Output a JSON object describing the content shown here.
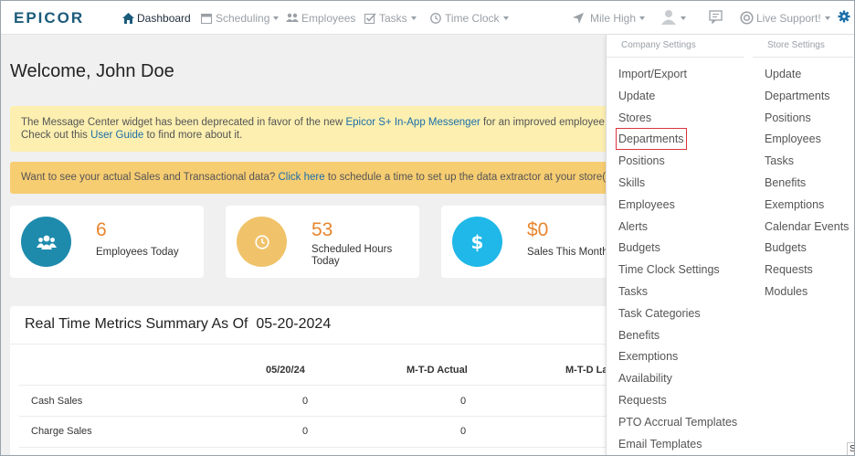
{
  "brand": {
    "logo_text": "EPICOR",
    "logo_color": "#1b5b7a"
  },
  "nav": {
    "dashboard": "Dashboard",
    "scheduling": "Scheduling",
    "employees": "Employees",
    "tasks": "Tasks",
    "time_clock": "Time Clock",
    "store": "Mile High",
    "support": "Live Support!"
  },
  "welcome": "Welcome, John Doe",
  "alerts": {
    "message_center": {
      "line1_a": "The Message Center widget has been deprecated in favor of the new ",
      "line1_link": "Epicor S+ In-App Messenger",
      "line1_b": " for an improved employee collab",
      "line2_a": "Check out this ",
      "line2_link": "User Guide",
      "line2_b": " to find more about it."
    },
    "sales_data": {
      "text_a": "Want to see your actual Sales and Transactional data? ",
      "link": "Click here",
      "text_b": " to schedule a time to set up the data extractor at your store(s)."
    }
  },
  "cards": [
    {
      "value": "6",
      "label": "Employees Today",
      "icon": "users-icon",
      "color": "#1e8bad"
    },
    {
      "value": "53",
      "label": "Scheduled Hours Today",
      "label_line1": "Scheduled Hours",
      "label_line2": "Today",
      "icon": "clock-icon",
      "color": "#f0c36a"
    },
    {
      "value": "$0",
      "label": "Sales This Month",
      "icon": "dollar-icon",
      "color": "#1fb8e8"
    }
  ],
  "metrics": {
    "title": "Real Time Metrics Summary As Of  05-20-2024",
    "columns": [
      "05/20/24",
      "M-T-D Actual",
      "M-T-D La"
    ],
    "rows": [
      {
        "label": "Cash Sales",
        "values": [
          "0",
          "0"
        ]
      },
      {
        "label": "Charge Sales",
        "values": [
          "0",
          "0"
        ]
      }
    ]
  },
  "dropdown": {
    "company_header": "Company Settings",
    "store_header": "Store Settings",
    "company_items": [
      "Import/Export",
      "Update",
      "Stores",
      "Departments",
      "Positions",
      "Skills",
      "Employees",
      "Alerts",
      "Budgets",
      "Time Clock Settings",
      "Tasks",
      "Task Categories",
      "Benefits",
      "Exemptions",
      "Availability",
      "Requests",
      "PTO Accrual Templates",
      "Email Templates"
    ],
    "store_items": [
      "Update",
      "Departments",
      "Positions",
      "Employees",
      "Tasks",
      "Benefits",
      "Exemptions",
      "Calendar Events",
      "Budgets",
      "Requests",
      "Modules"
    ],
    "highlighted": "Departments"
  },
  "peek_text": "S"
}
